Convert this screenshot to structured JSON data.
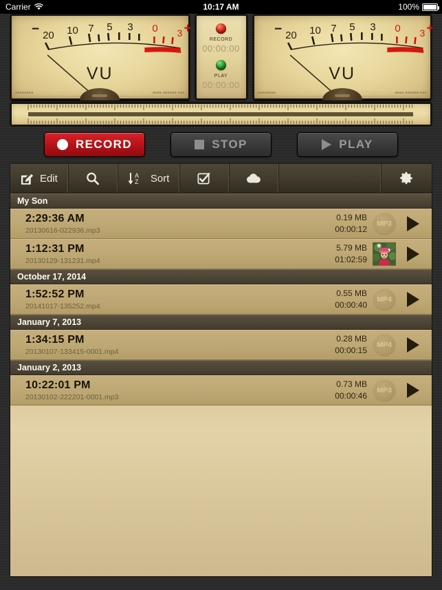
{
  "statusbar": {
    "carrier": "Carrier",
    "wifi_icon": "wifi-icon",
    "time": "10:17 AM",
    "battery_percent": "100%",
    "battery_icon": "battery-full-icon"
  },
  "meters": {
    "left": {
      "label": "VU",
      "scale_marks": [
        "−",
        "20",
        "10",
        "7",
        "5",
        "3",
        "0",
        "3",
        "+"
      ],
      "footer_left": "■■■■■■■■",
      "footer_right": "■■■■ ■■■■■■ ■■■"
    },
    "right": {
      "label": "VU",
      "scale_marks": [
        "−",
        "20",
        "10",
        "7",
        "5",
        "3",
        "0",
        "3",
        "+"
      ],
      "footer_left": "■■■■■■■■",
      "footer_right": "■■■■ ■■■■■■ ■■■"
    },
    "center": {
      "record_led": "record-led",
      "record_label": "RECORD",
      "record_time": "00:00:00",
      "play_led": "play-led",
      "play_label": "PLAY",
      "play_time": "00:00:00"
    }
  },
  "transport": {
    "record_label": "RECORD",
    "stop_label": "STOP",
    "play_label": "PLAY",
    "record_enabled": true,
    "stop_enabled": false,
    "play_enabled": false,
    "record_color": "#b81318"
  },
  "toolbar": {
    "edit_label": "Edit",
    "edit_icon": "edit-pencil-icon",
    "search_icon": "search-icon",
    "sort_label": "Sort",
    "sort_icon": "sort-az-icon",
    "select_icon": "checkbox-check-icon",
    "cloud_icon": "cloud-icon",
    "settings_icon": "gear-icon"
  },
  "list": {
    "sections": [
      {
        "title": "My Son",
        "rows": [
          {
            "time": "2:29:36 AM",
            "filename": "20130616-022936.mp3",
            "size": "0.19 MB",
            "duration": "00:00:12",
            "badge": "MP3",
            "has_thumbnail": false,
            "play_icon": "play-icon"
          },
          {
            "time": "1:12:31 PM",
            "filename": "20130129-131231.mp4",
            "size": "5.79 MB",
            "duration": "01:02:59",
            "badge": "",
            "has_thumbnail": true,
            "thumbnail_icon": "video-thumbnail-child-pink-hat",
            "play_icon": "play-icon"
          }
        ]
      },
      {
        "title": "October 17, 2014",
        "rows": [
          {
            "time": "1:52:52 PM",
            "filename": "20141017-135252.mp4",
            "size": "0.55 MB",
            "duration": "00:00:40",
            "badge": "MP4",
            "has_thumbnail": false,
            "play_icon": "play-icon"
          }
        ]
      },
      {
        "title": "January 7, 2013",
        "rows": [
          {
            "time": "1:34:15 PM",
            "filename": "20130107-133415-0001.mp4",
            "size": "0.28 MB",
            "duration": "00:00:15",
            "badge": "MP4",
            "has_thumbnail": false,
            "play_icon": "play-icon"
          }
        ]
      },
      {
        "title": "January 2, 2013",
        "rows": [
          {
            "time": "10:22:01 PM",
            "filename": "20130102-222201-0001.mp3",
            "size": "0.73 MB",
            "duration": "00:00:46",
            "badge": "MP3",
            "has_thumbnail": false,
            "play_icon": "play-icon"
          }
        ]
      }
    ]
  }
}
